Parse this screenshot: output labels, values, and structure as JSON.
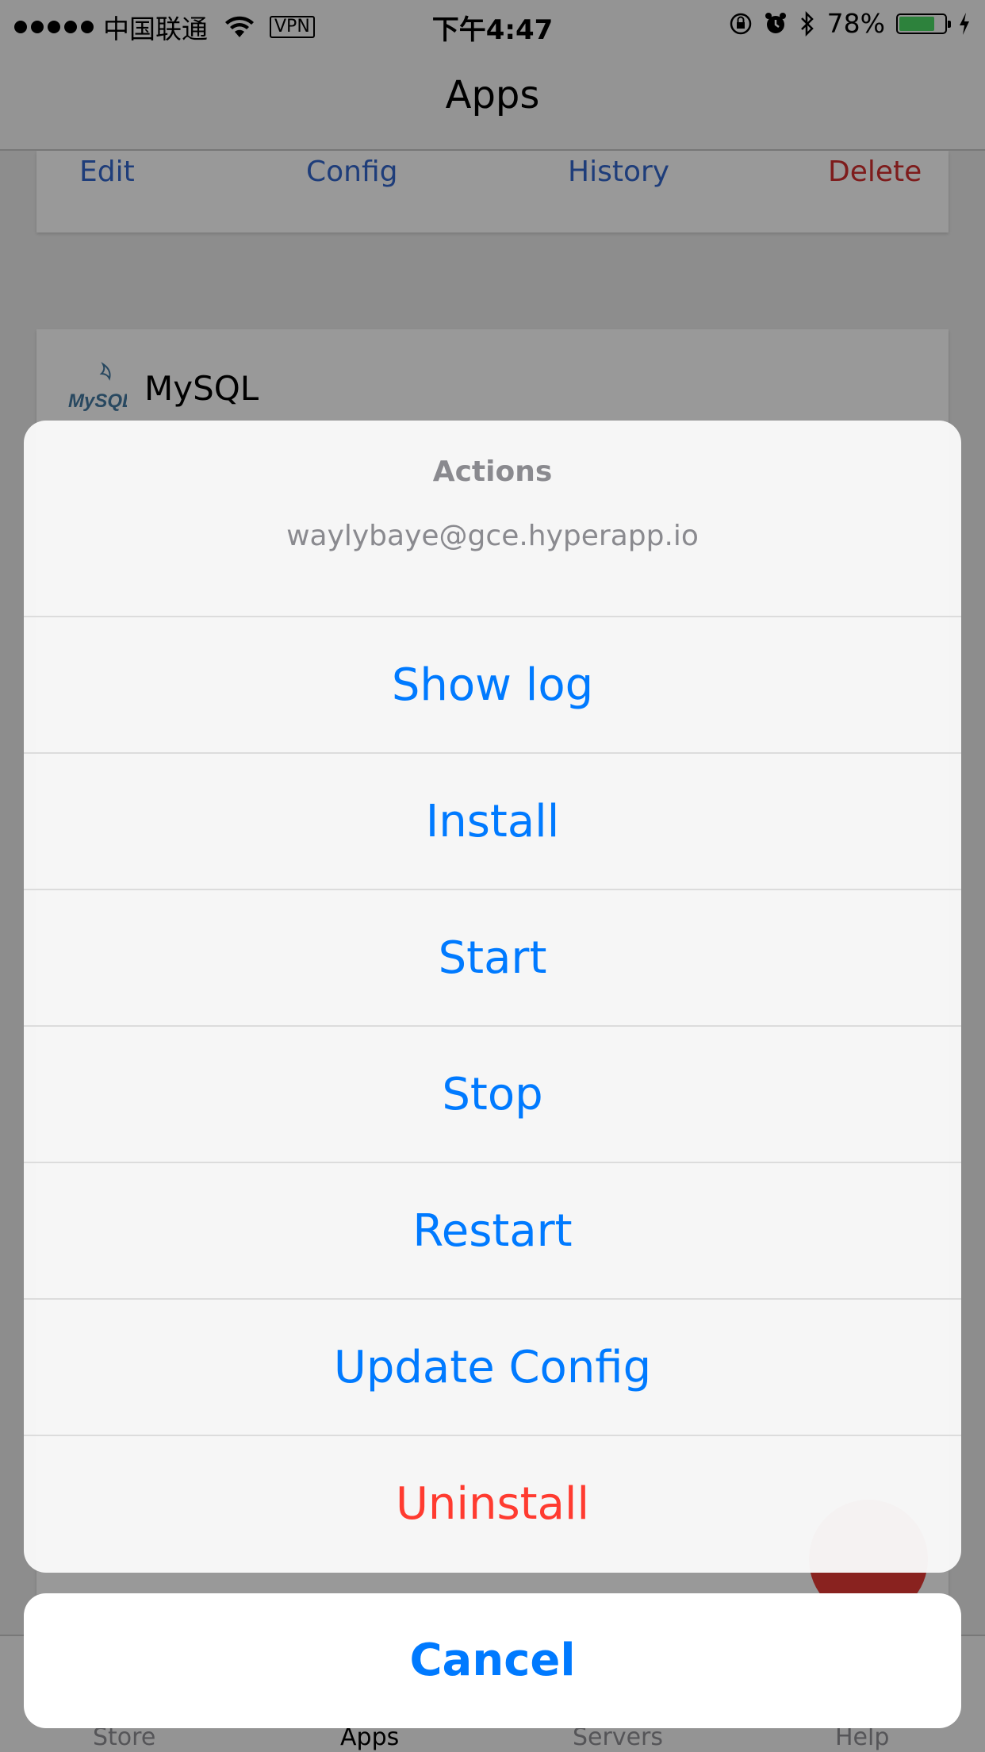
{
  "status_bar": {
    "carrier": "中国联通",
    "vpn": "VPN",
    "time": "下午4:47",
    "battery_percent": "78%",
    "battery_level": 0.78,
    "battery_color": "#4cd964"
  },
  "nav": {
    "title": "Apps"
  },
  "background_card": {
    "actions": {
      "edit": "Edit",
      "config": "Config",
      "history": "History",
      "delete": "Delete"
    }
  },
  "mysql_card": {
    "logo_text": "MySQL",
    "name": "MySQL"
  },
  "tabs": [
    "Store",
    "Apps",
    "Servers",
    "Help"
  ],
  "action_sheet": {
    "title": "Actions",
    "subtitle": "waylybaye@gce.hyperapp.io",
    "buttons": [
      {
        "label": "Show log"
      },
      {
        "label": "Install"
      },
      {
        "label": "Start"
      },
      {
        "label": "Stop"
      },
      {
        "label": "Restart"
      },
      {
        "label": "Update Config"
      },
      {
        "label": "Uninstall"
      }
    ],
    "cancel": "Cancel"
  },
  "colors": {
    "accent": "#007aff",
    "destructive": "#ff3b30"
  }
}
